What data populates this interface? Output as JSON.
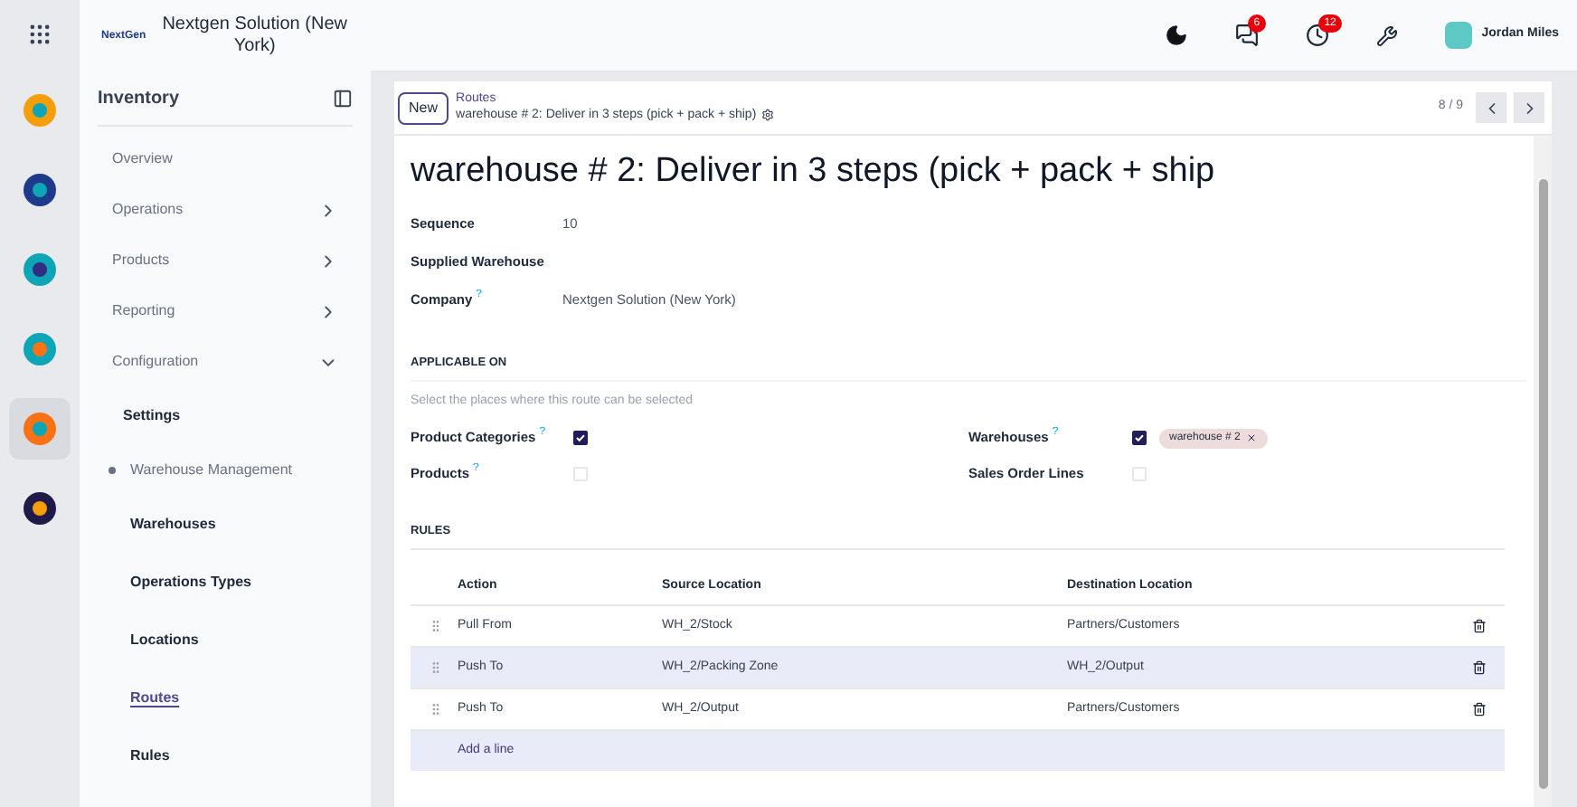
{
  "company": {
    "logo": "NextGen",
    "name": "Nextgen Solution (New York)"
  },
  "rail": [
    {
      "selected": false
    },
    {
      "selected": false
    },
    {
      "selected": false
    },
    {
      "selected": false
    },
    {
      "selected": true
    },
    {
      "selected": false
    }
  ],
  "topbar": {
    "messages_badge": "6",
    "activities_badge": "12",
    "user": "Jordan Miles"
  },
  "sidebar": {
    "title": "Inventory",
    "items": [
      {
        "label": "Overview",
        "selected": false
      },
      {
        "label": "Operations",
        "expanded": false,
        "selected": false
      },
      {
        "label": "Products",
        "expanded": false,
        "selected": false
      },
      {
        "label": "Reporting",
        "expanded": false,
        "selected": false
      },
      {
        "label": "Configuration",
        "expanded": true,
        "selected": false,
        "children": [
          {
            "kind": "link",
            "label": "Settings",
            "selected": false
          },
          {
            "kind": "section",
            "label": "Warehouse Management",
            "children": [
              {
                "kind": "link",
                "label": "Warehouses",
                "selected": false
              },
              {
                "kind": "link",
                "label": "Operations Types",
                "selected": false
              },
              {
                "kind": "link",
                "label": "Locations",
                "selected": false
              },
              {
                "kind": "link",
                "label": "Routes",
                "selected": true
              },
              {
                "kind": "link",
                "label": "Rules",
                "selected": false
              }
            ]
          }
        ]
      }
    ]
  },
  "control_panel": {
    "new_button": "New",
    "breadcrumb": "Routes",
    "record": "warehouse # 2: Deliver in 3 steps (pick + pack + ship)",
    "pager": "8 / 9"
  },
  "form": {
    "title": "warehouse # 2: Deliver in 3 steps (pick + pack + ship",
    "fields": [
      {
        "label": "Sequence",
        "value": "10"
      },
      {
        "label": "Supplied Warehouse"
      },
      {
        "label": "Company",
        "help": "?",
        "value": "Nextgen Solution (New York)"
      }
    ],
    "applicable_on": {
      "heading": "APPLICABLE ON",
      "hint": "Select the places where this route can be selected",
      "options": [
        {
          "label": "Product Categories",
          "help": "?",
          "checked": true
        },
        {
          "label": "Warehouses",
          "help": "?",
          "checked": true,
          "tags": [
            "warehouse # 2"
          ]
        },
        {
          "label": "Products",
          "help": "?",
          "checked": false
        },
        {
          "label": "Sales Order Lines",
          "checked": false
        }
      ]
    },
    "rules": {
      "heading": "RULES",
      "columns": [
        "Action",
        "Source Location",
        "Destination Location"
      ],
      "rows": [
        {
          "cells": [
            "Pull From",
            "WH_2/Stock",
            "Partners/Customers"
          ],
          "selected": false
        },
        {
          "cells": [
            "Push To",
            "WH_2/Packing Zone",
            "WH_2/Output"
          ],
          "selected": true
        },
        {
          "cells": [
            "Push To",
            "WH_2/Output",
            "Partners/Customers"
          ],
          "selected": false
        }
      ],
      "add_line": "Add a line"
    }
  }
}
